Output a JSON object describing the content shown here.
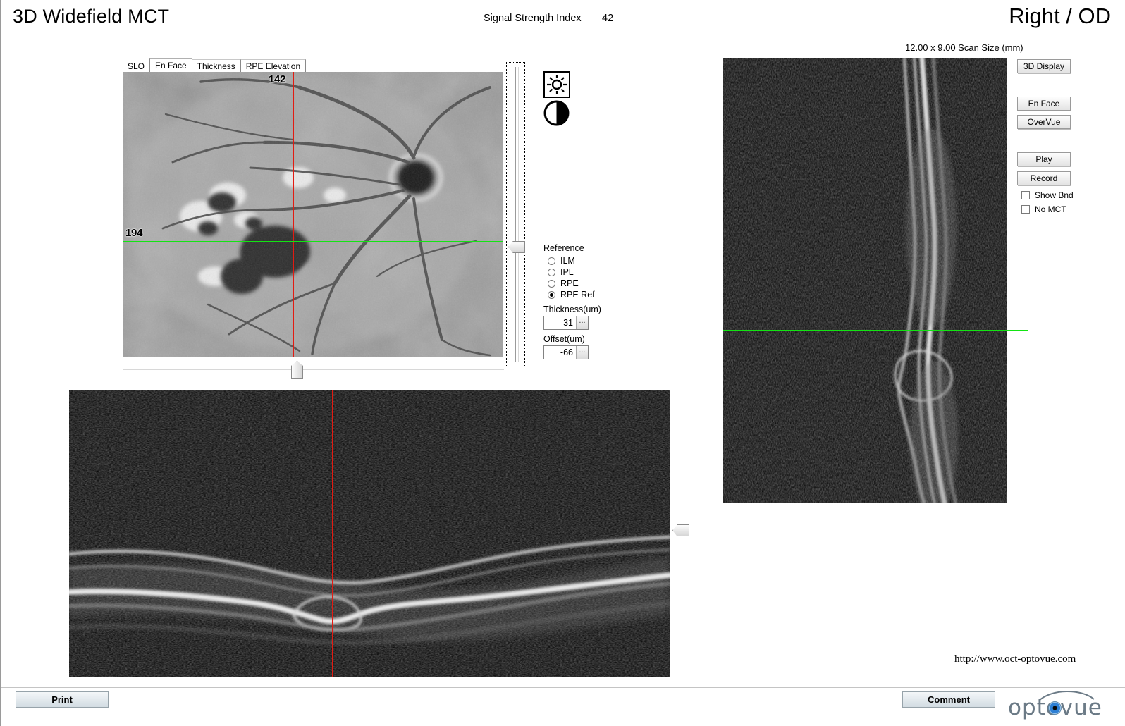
{
  "header": {
    "title": "3D Widefield MCT",
    "ssi_label": "Signal Strength Index",
    "ssi_value": "42",
    "eye": "Right / OD"
  },
  "enface": {
    "tabs": [
      {
        "label": "SLO",
        "selected": false
      },
      {
        "label": "En Face",
        "selected": true
      },
      {
        "label": "Thickness",
        "selected": false
      },
      {
        "label": "RPE Elevation",
        "selected": false
      }
    ],
    "vertical_line_label": "142",
    "horizontal_line_label": "194",
    "line_colors": {
      "vertical": "#e21b12",
      "horizontal": "#13e413"
    }
  },
  "tools": {
    "brightness_icon": "brightness-sun-icon",
    "contrast_icon": "contrast-half-circle-icon"
  },
  "reference": {
    "title": "Reference",
    "options": [
      {
        "label": "ILM",
        "selected": false
      },
      {
        "label": "IPL",
        "selected": false
      },
      {
        "label": "RPE",
        "selected": false
      },
      {
        "label": "RPE Ref",
        "selected": true
      }
    ],
    "thickness_label": "Thickness(um)",
    "thickness_value": "31",
    "offset_label": "Offset(um)",
    "offset_value": "-66",
    "ellipsis": "..."
  },
  "right_panel": {
    "scan_size": "12.00 x 9.00 Scan Size (mm)",
    "buttons": [
      {
        "label": "3D Display"
      },
      {
        "label": "En Face"
      },
      {
        "label": "OverVue"
      },
      {
        "label": "Play"
      },
      {
        "label": "Record"
      }
    ],
    "checkboxes": [
      {
        "label": "Show Bnd",
        "checked": false
      },
      {
        "label": "No MCT",
        "checked": false
      }
    ]
  },
  "footer": {
    "print_label": "Print",
    "comment_label": "Comment",
    "url": "http://www.oct-optovue.com",
    "logo_text": "optovue"
  }
}
